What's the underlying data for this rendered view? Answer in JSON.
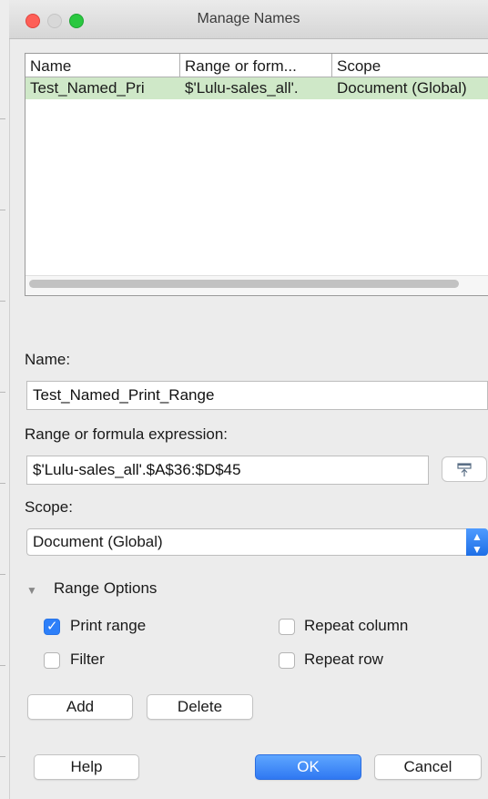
{
  "window": {
    "title": "Manage Names"
  },
  "table": {
    "columns": [
      "Name",
      "Range or form...",
      "Scope"
    ],
    "rows": [
      {
        "name": "Test_Named_Pri",
        "range": "$'Lulu-sales_all'.",
        "scope": "Document (Global)"
      }
    ]
  },
  "form": {
    "name_label": "Name:",
    "name_value": "Test_Named_Print_Range",
    "range_label": "Range or formula expression:",
    "range_value": "$'Lulu-sales_all'.$A$36:$D$45",
    "scope_label": "Scope:",
    "scope_value": "Document (Global)"
  },
  "range_options": {
    "label": "Range Options",
    "print_range": {
      "label": "Print range",
      "checked": true
    },
    "filter": {
      "label": "Filter",
      "checked": false
    },
    "repeat_column": {
      "label": "Repeat column",
      "checked": false
    },
    "repeat_row": {
      "label": "Repeat row",
      "checked": false
    }
  },
  "buttons": {
    "add": "Add",
    "delete": "Delete",
    "help": "Help",
    "ok": "OK",
    "cancel": "Cancel"
  },
  "colors": {
    "selection_row": "#cfe8c8",
    "accent": "#2d7ff9"
  }
}
